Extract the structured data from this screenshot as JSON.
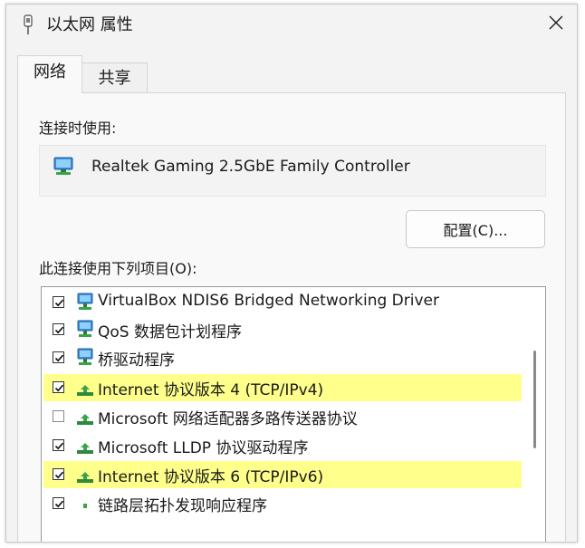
{
  "window": {
    "title": "以太网 属性",
    "close_symbol": "✕"
  },
  "tabs": [
    {
      "label": "网络",
      "active": true
    },
    {
      "label": "共享",
      "active": false
    }
  ],
  "network": {
    "connect_using_label": "连接时使用:",
    "adapter_name": "Realtek Gaming 2.5GbE Family Controller",
    "configure_button": "配置(C)...",
    "items_label": "此连接使用下列项目(O):",
    "items": [
      {
        "label": "VirtualBox NDIS6 Bridged Networking Driver",
        "checked": true,
        "selected": false,
        "icon": "network-service-icon"
      },
      {
        "label": "QoS 数据包计划程序",
        "checked": true,
        "selected": false,
        "icon": "network-service-icon"
      },
      {
        "label": "桥驱动程序",
        "checked": true,
        "selected": false,
        "icon": "network-service-icon"
      },
      {
        "label": "Internet 协议版本 4 (TCP/IPv4)",
        "checked": true,
        "selected": true,
        "icon": "protocol-icon"
      },
      {
        "label": "Microsoft 网络适配器多路传送器协议",
        "checked": false,
        "selected": false,
        "icon": "protocol-icon"
      },
      {
        "label": "Microsoft LLDP 协议驱动程序",
        "checked": true,
        "selected": false,
        "icon": "protocol-icon"
      },
      {
        "label": "Internet 协议版本 6 (TCP/IPv6)",
        "checked": true,
        "selected": true,
        "icon": "protocol-icon"
      },
      {
        "label": "链路层拓扑发现响应程序",
        "checked": true,
        "selected": false,
        "icon": "protocol-icon"
      }
    ]
  },
  "colors": {
    "highlight": "#ffff8c",
    "window_bg": "#f3f3f3",
    "protocol_green": "#3aa34a",
    "service_blue": "#3b8fd6"
  }
}
